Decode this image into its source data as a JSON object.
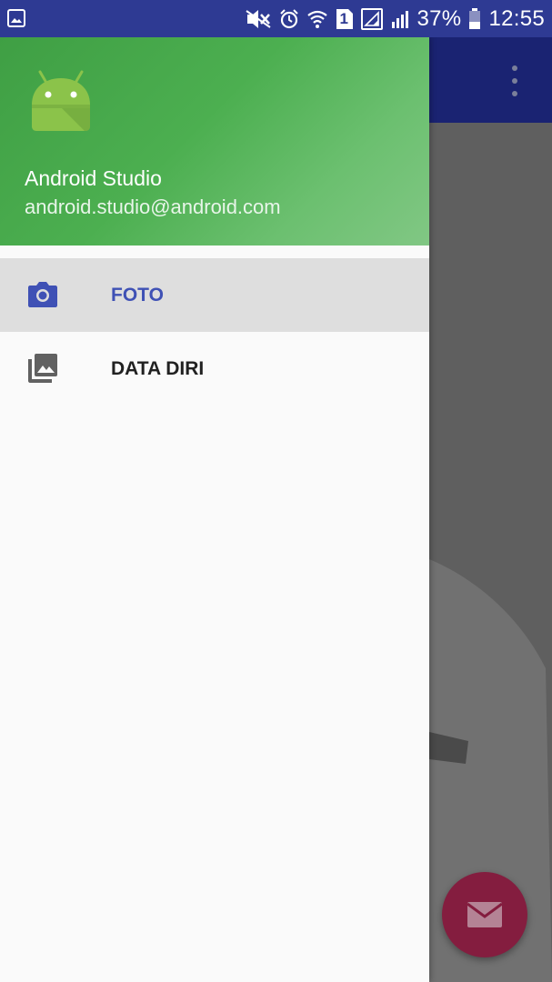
{
  "status_bar": {
    "battery": "37%",
    "time": "12:55",
    "sim_slot": "1",
    "icons": [
      "gallery-notification-icon",
      "mute-icon",
      "alarm-icon",
      "wifi-icon",
      "sim-icon",
      "signal-icon",
      "battery-icon"
    ]
  },
  "drawer": {
    "header": {
      "name": "Android Studio",
      "email": "android.studio@android.com"
    },
    "items": [
      {
        "label": "FOTO",
        "icon": "camera-icon",
        "selected": true
      },
      {
        "label": "DATA DIRI",
        "icon": "photo-library-icon",
        "selected": false
      }
    ]
  },
  "background_app": {
    "menu_icon": "overflow-menu-icon",
    "fab_icon": "mail-icon"
  },
  "colors": {
    "status_bar": "#2e3a93",
    "toolbar": "#1a2372",
    "drawer_header": "#4caf50",
    "accent": "#3f51b5",
    "fab": "#841d3f"
  }
}
